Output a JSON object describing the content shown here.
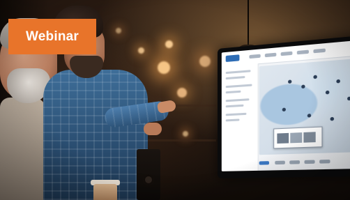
{
  "badge": {
    "label": "Webinar",
    "color": "#e8742a"
  }
}
